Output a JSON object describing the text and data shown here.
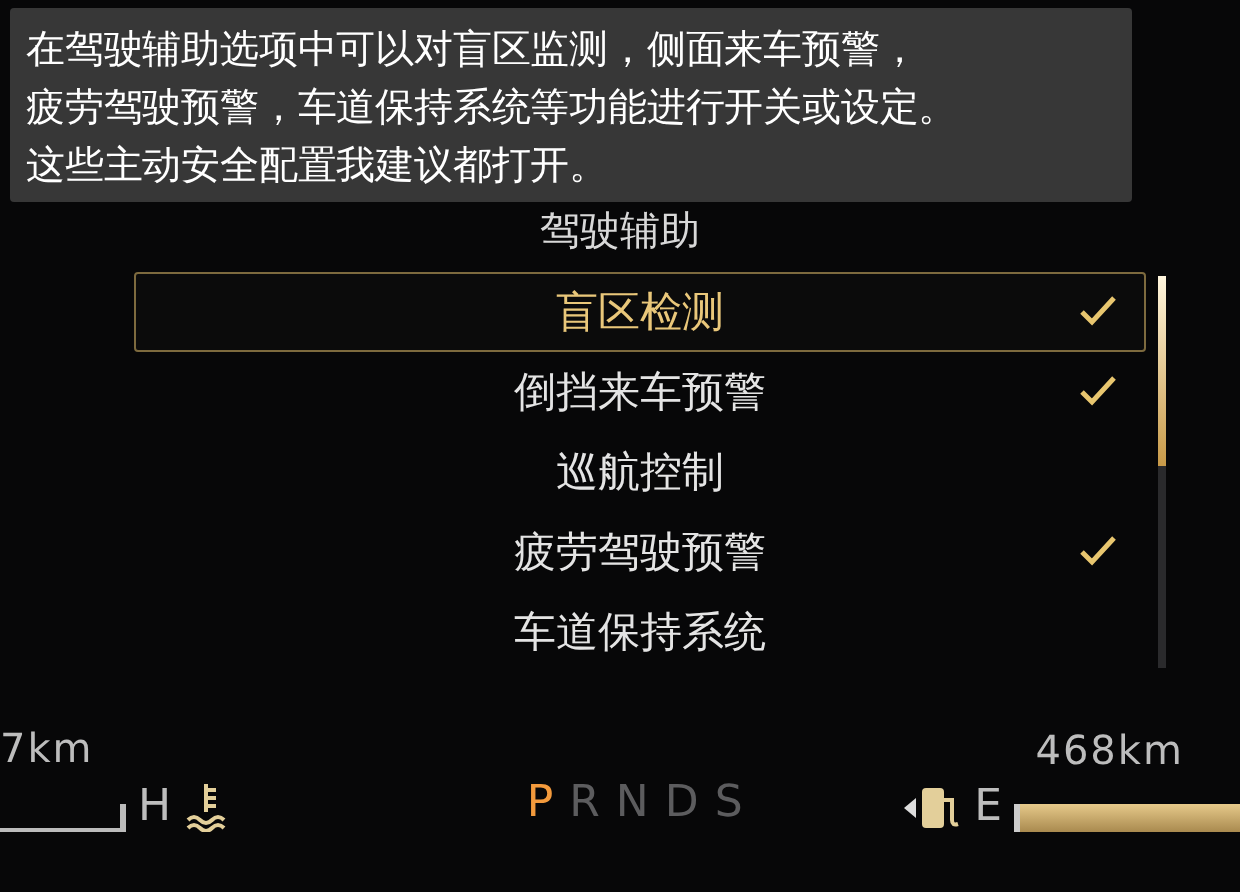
{
  "caption": [
    "在驾驶辅助选项中可以对盲区监测，侧面来车预警，",
    "疲劳驾驶预警，车道保持系统等功能进行开关或设定。",
    "这些主动安全配置我建议都打开。"
  ],
  "menu": {
    "title": "驾驶辅助",
    "items": [
      {
        "label": "盲区检测",
        "checked": true,
        "selected": true
      },
      {
        "label": "倒挡来车预警",
        "checked": true,
        "selected": false
      },
      {
        "label": "巡航控制",
        "checked": false,
        "selected": false
      },
      {
        "label": "疲劳驾驶预警",
        "checked": true,
        "selected": false
      },
      {
        "label": "车道保持系统",
        "checked": false,
        "selected": false
      }
    ]
  },
  "left_cluster": {
    "distance": "7km",
    "gauge_mark": "H"
  },
  "gears": [
    {
      "label": "P",
      "selected": true
    },
    {
      "label": "R",
      "selected": false
    },
    {
      "label": "N",
      "selected": false
    },
    {
      "label": "D",
      "selected": false
    },
    {
      "label": "S",
      "selected": false
    }
  ],
  "right_cluster": {
    "range": "468km",
    "fuel_mark": "E"
  }
}
